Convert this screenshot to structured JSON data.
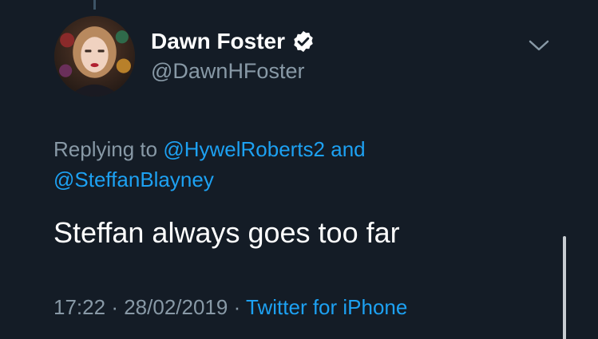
{
  "tweet": {
    "author": {
      "display_name": "Dawn Foster",
      "handle": "@DawnHFoster",
      "verified": true
    },
    "reply_context": {
      "prefix": "Replying to",
      "mentions": [
        "@HywelRoberts2",
        "@SteffanBlayney"
      ],
      "conjunction": "and"
    },
    "text": "Steffan always goes too far",
    "time": "17:22",
    "date": "28/02/2019",
    "separator": "·",
    "source": "Twitter for iPhone"
  },
  "icons": {
    "verified": "verified-badge-icon",
    "menu": "chevron-down-icon"
  },
  "colors": {
    "background": "#141c26",
    "text_primary": "#ffffff",
    "text_secondary": "#8899a6",
    "accent": "#1da1f2"
  }
}
